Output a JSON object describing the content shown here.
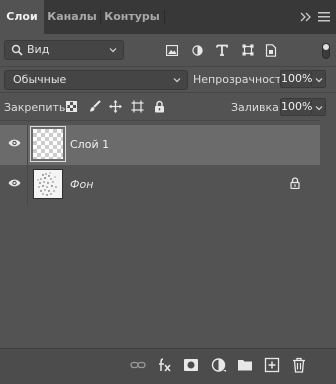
{
  "tabs": [
    {
      "label": "Слои",
      "active": true
    },
    {
      "label": "Каналы",
      "active": false
    },
    {
      "label": "Контуры",
      "active": false
    }
  ],
  "filter": {
    "kind_value": "Вид",
    "filter_icons": [
      "image-filter-icon",
      "adjustment-filter-icon",
      "type-filter-icon",
      "shape-filter-icon",
      "smart-object-filter-icon"
    ]
  },
  "blend": {
    "mode_value": "Обычные",
    "opacity_label": "Непрозрачность:",
    "opacity_value": "100%"
  },
  "lock": {
    "label": "Закрепить:",
    "fill_label": "Заливка:",
    "fill_value": "100%",
    "lock_icons": [
      "lock-transparent-pixels-icon",
      "lock-image-pixels-icon",
      "lock-position-icon",
      "lock-artboard-icon",
      "lock-all-icon"
    ]
  },
  "layers": [
    {
      "name": "Слой 1",
      "selected": true,
      "visible": true,
      "locked": false,
      "italic": false
    },
    {
      "name": "Фон",
      "selected": false,
      "visible": true,
      "locked": true,
      "italic": true
    }
  ],
  "bottom_buttons": [
    "link-layers-icon",
    "fx-icon",
    "add-mask-icon",
    "adjustment-layer-icon",
    "new-group-icon",
    "new-layer-icon",
    "delete-icon"
  ],
  "colors": {
    "panel_bg": "#535353",
    "selected_row": "#6b6b6b",
    "tab_bar": "#383838"
  }
}
